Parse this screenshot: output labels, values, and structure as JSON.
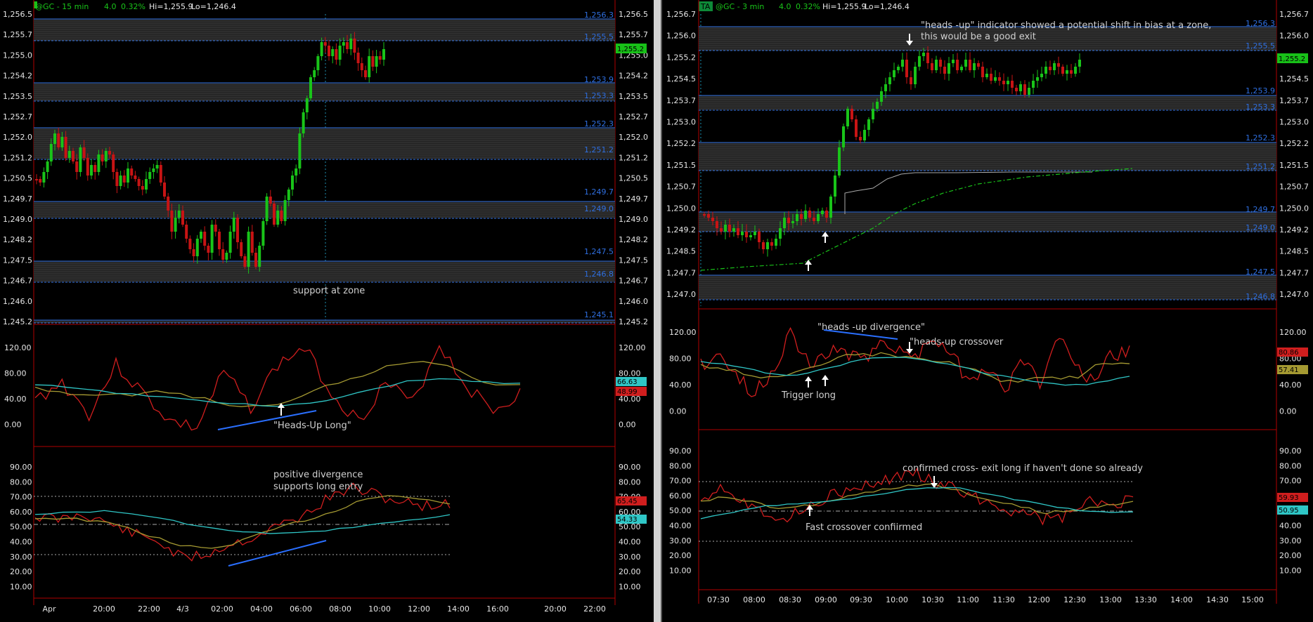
{
  "colors": {
    "background": "#000000",
    "up_candle": "#19c419",
    "down_candle": "#c81414",
    "zone_line": "#2f6fe0",
    "oscillator_red": "#d01e1e",
    "oscillator_olive": "#a59a32",
    "oscillator_cyan": "#2fc6c6",
    "separator_red": "#b00000",
    "annotation_blue": "#2a6fff",
    "price_box_green": "#18c118",
    "label_text": "#d0d0d0"
  },
  "left_chart": {
    "header": {
      "symbol": "@GC - 15 min",
      "change": "4.0",
      "pct": "0.32%",
      "hi": "Hi=1,255.9",
      "lo": "Lo=1,246.4"
    },
    "price_ticks": [
      "1,256.5",
      "1,255.7",
      "1,255.0",
      "1,254.2",
      "1,253.5",
      "1,252.7",
      "1,252.0",
      "1,251.2",
      "1,250.5",
      "1,249.7",
      "1,249.0",
      "1,248.2",
      "1,247.5",
      "1,246.7",
      "1,246.0",
      "1,245.2"
    ],
    "zone_labels": [
      "1,256.3",
      "1,255.5",
      "1,253.9",
      "1,253.3",
      "1,252.3",
      "1,251.2",
      "1,249.7",
      "1,249.0",
      "1,247.5",
      "1,246.8",
      "1,245.1"
    ],
    "current_price": "1,255.2",
    "osc1_ticks": [
      "120.00",
      "80.00",
      "40.00",
      "0.00"
    ],
    "osc1_values": [
      "66.63",
      "48.99"
    ],
    "osc2_ticks": [
      "90.00",
      "80.00",
      "70.00",
      "60.00",
      "50.00",
      "40.00",
      "30.00",
      "20.00",
      "10.00"
    ],
    "osc2_values": [
      "65.45",
      "54.33"
    ],
    "time_ticks": [
      "Apr",
      "20:00",
      "22:00",
      "4/3",
      "02:00",
      "04:00",
      "06:00",
      "08:00",
      "10:00",
      "12:00",
      "14:00",
      "16:00",
      "20:00",
      "22:00"
    ],
    "annotations": {
      "support": "support at zone",
      "heads_up_long": "\"Heads-Up Long\"",
      "pos_div_1": "positive divergence",
      "pos_div_2": "supports long entry"
    }
  },
  "right_chart": {
    "badge": "TA",
    "header": {
      "symbol": "@GC - 3 min",
      "change": "4.0",
      "pct": "0.32%",
      "hi": "Hi=1,255.9",
      "lo": "Lo=1,246.4"
    },
    "price_ticks": [
      "1,256.7",
      "1,256.0",
      "1,255.2",
      "1,254.5",
      "1,253.7",
      "1,253.0",
      "1,252.2",
      "1,251.5",
      "1,250.7",
      "1,250.0",
      "1,249.2",
      "1,248.5",
      "1,247.7",
      "1,247.0"
    ],
    "zone_labels": [
      "1,256.3",
      "1,255.5",
      "1,253.9",
      "1,253.3",
      "1,252.3",
      "1,251.2",
      "1,249.7",
      "1,249.0",
      "1,247.5",
      "1,246.8"
    ],
    "current_price": "1,255.2",
    "osc1_ticks": [
      "120.00",
      "80.00",
      "40.00",
      "0.00"
    ],
    "osc1_values": [
      "80.86",
      "57.41"
    ],
    "osc2_ticks": [
      "90.00",
      "80.00",
      "70.00",
      "60.00",
      "50.00",
      "40.00",
      "30.00",
      "20.00",
      "10.00"
    ],
    "osc2_values": [
      "59.93",
      "50.95"
    ],
    "time_ticks": [
      "07:30",
      "08:00",
      "08:30",
      "09:00",
      "09:30",
      "10:00",
      "10:30",
      "11:00",
      "11:30",
      "12:00",
      "12:30",
      "13:00",
      "13:30",
      "14:00",
      "14:30",
      "15:00"
    ],
    "annotations": {
      "exit_1": "\"heads -up\" indicator showed a potential shift in bias at a zone,",
      "exit_2": "this would be a good exit",
      "hu_divergence": "\"heads -up divergence\"",
      "hu_crossover": "\"heads-up crossover",
      "trigger_long": "Trigger long",
      "confirmed_cross": "confirmed cross- exit long if haven't done so already",
      "fast_crossover": "Fast crossover confiirmed"
    }
  }
}
